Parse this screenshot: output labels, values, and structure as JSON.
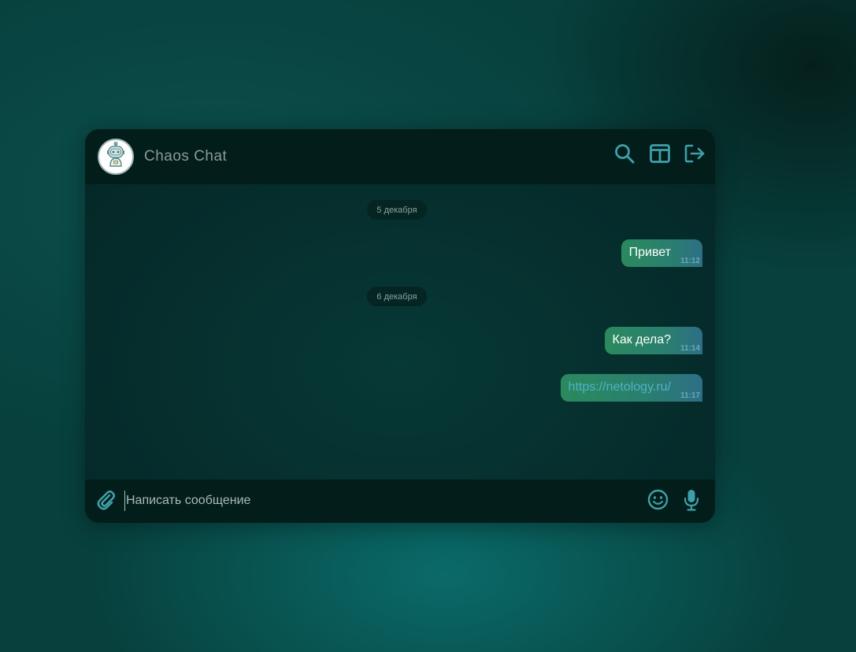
{
  "header": {
    "title": "Chaos Chat",
    "avatar_icon": "robot-avatar-icon",
    "actions": [
      {
        "name": "search-button",
        "icon": "search-icon"
      },
      {
        "name": "layout-button",
        "icon": "columns-icon"
      },
      {
        "name": "logout-button",
        "icon": "logout-icon"
      }
    ]
  },
  "messages": {
    "groups": [
      {
        "date": "5 декабря",
        "items": [
          {
            "text": "Привет",
            "time": "11:12",
            "type": "text"
          }
        ]
      },
      {
        "date": "6 декабря",
        "items": [
          {
            "text": "Как дела?",
            "time": "11:14",
            "type": "text"
          },
          {
            "text": "https://netology.ru/",
            "time": "11:17",
            "type": "link"
          }
        ]
      }
    ]
  },
  "composer": {
    "placeholder": "Написать сообщение",
    "value": "",
    "attach_icon": "paperclip-icon",
    "emoji_icon": "smiley-icon",
    "mic_icon": "microphone-icon"
  },
  "colors": {
    "accent": "#3f9fa8",
    "bubble_start": "#2a8a5e",
    "bubble_end": "#2d6f86",
    "header_bg": "#031d1b",
    "link": "#4fb3c6"
  }
}
